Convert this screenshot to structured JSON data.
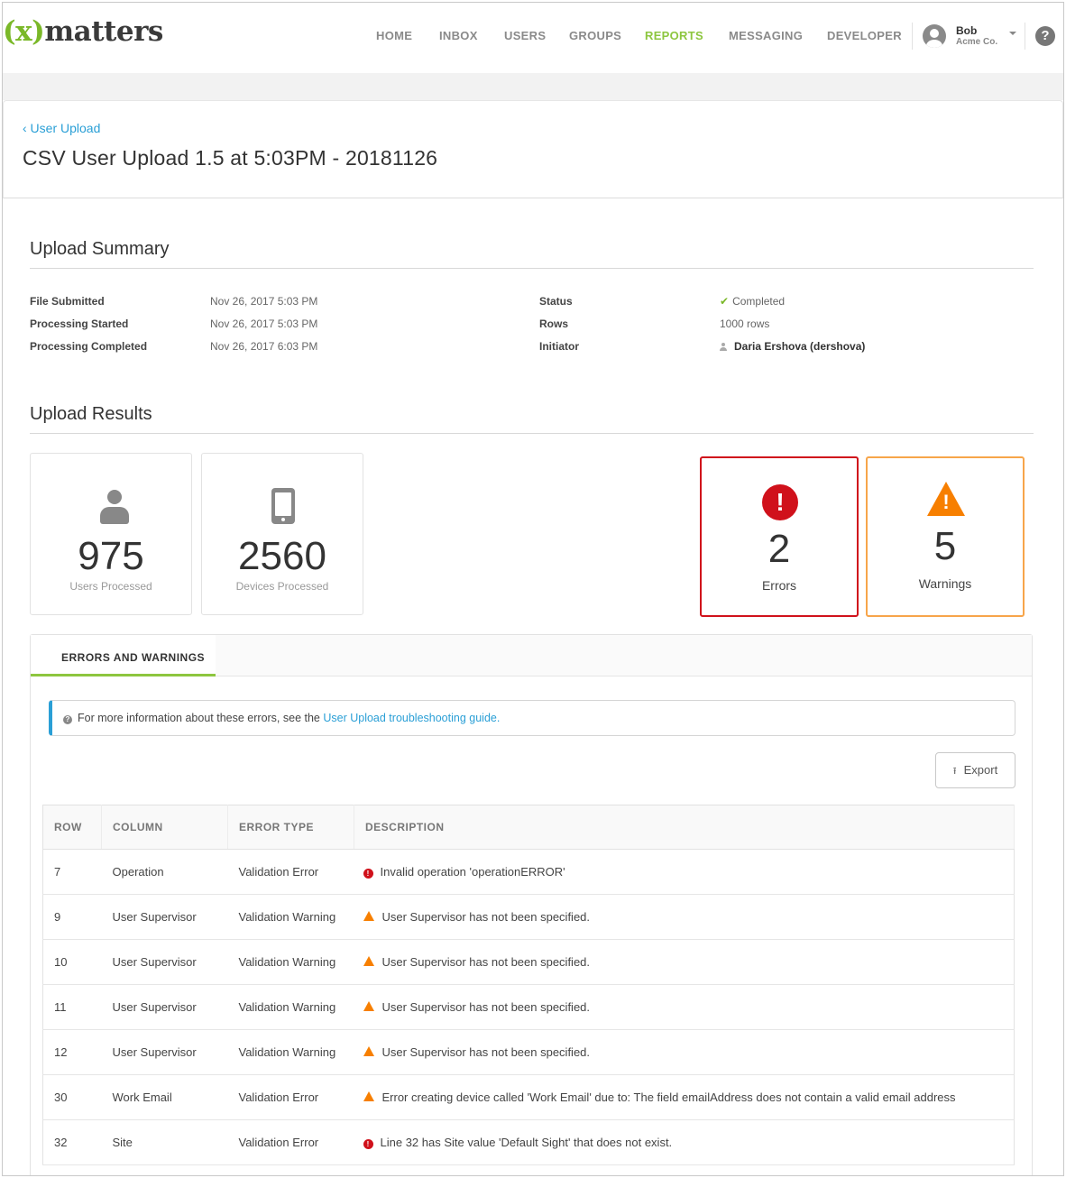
{
  "brand": {
    "logo_paren": "(x)",
    "logo_word": "matters"
  },
  "nav": {
    "items": [
      {
        "label": "HOME",
        "active": false
      },
      {
        "label": "INBOX",
        "active": false
      },
      {
        "label": "USERS",
        "active": false
      },
      {
        "label": "GROUPS",
        "active": false
      },
      {
        "label": "REPORTS",
        "active": true
      },
      {
        "label": "MESSAGING",
        "active": false
      },
      {
        "label": "DEVELOPER",
        "active": false
      }
    ],
    "user_name": "Bob",
    "user_org": "Acme Co.",
    "help_glyph": "?"
  },
  "header": {
    "breadcrumb": "‹ User Upload",
    "title": "CSV User Upload 1.5 at 5:03PM - 20181126"
  },
  "summary": {
    "title": "Upload Summary",
    "left": [
      {
        "label": "File Submitted",
        "value": "Nov 26, 2017 5:03 PM"
      },
      {
        "label": "Processing Started",
        "value": "Nov 26, 2017 5:03 PM"
      },
      {
        "label": "Processing Completed",
        "value": "Nov 26, 2017 6:03 PM"
      }
    ],
    "right": [
      {
        "label": "Status",
        "value": "Completed"
      },
      {
        "label": "Rows",
        "value": "1000 rows"
      },
      {
        "label": "Initiator",
        "value": "Daria Ershova (dershova)"
      }
    ]
  },
  "results": {
    "title": "Upload Results",
    "users": {
      "value": "975",
      "label": "Users Processed",
      "icon": "person-icon"
    },
    "devices": {
      "value": "2560",
      "label": "Devices Processed",
      "icon": "mobile-device-icon"
    },
    "errors": {
      "value": "2",
      "label": "Errors",
      "icon": "error-icon",
      "color": "#d0111b"
    },
    "warnings": {
      "value": "5",
      "label": "Warnings",
      "icon": "warning-icon",
      "color": "#f77f00"
    }
  },
  "ew": {
    "tab_label": "ERRORS AND WARNINGS",
    "info_text": "For more information about these errors, see the ",
    "info_link": "User Upload troubleshooting guide.",
    "export_label": "Export",
    "columns": [
      "ROW",
      "COLUMN",
      "ERROR TYPE",
      "DESCRIPTION"
    ],
    "rows": [
      {
        "row": "7",
        "column": "Operation",
        "type": "Validation Error",
        "severity": "error",
        "description": "Invalid operation 'operationERROR'"
      },
      {
        "row": "9",
        "column": "User Supervisor",
        "type": "Validation Warning",
        "severity": "warning",
        "description": "User Supervisor has not been specified."
      },
      {
        "row": "10",
        "column": "User Supervisor",
        "type": "Validation Warning",
        "severity": "warning",
        "description": "User Supervisor has not been specified."
      },
      {
        "row": "11",
        "column": "User Supervisor",
        "type": "Validation Warning",
        "severity": "warning",
        "description": "User Supervisor has not been specified."
      },
      {
        "row": "12",
        "column": "User Supervisor",
        "type": "Validation Warning",
        "severity": "warning",
        "description": "User Supervisor has not been specified."
      },
      {
        "row": "30",
        "column": "Work Email",
        "type": "Validation Error",
        "severity": "warning",
        "description": "Error creating device called 'Work Email' due to: The field emailAddress does not contain a valid email address"
      },
      {
        "row": "32",
        "column": "Site",
        "type": "Validation Error",
        "severity": "error",
        "description": "Line 32 has Site value 'Default Sight' that does not exist."
      }
    ]
  },
  "colors": {
    "brand_green": "#8dc63f",
    "link_blue": "#2a9fd6",
    "error_red": "#d0111b",
    "warning_orange": "#f77f00"
  }
}
